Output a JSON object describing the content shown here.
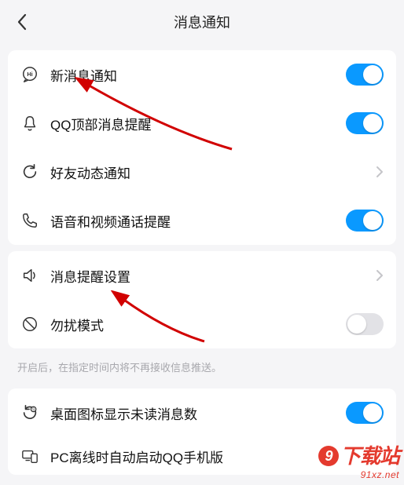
{
  "header": {
    "title": "消息通知"
  },
  "group1": {
    "items": [
      {
        "label": "新消息通知",
        "tail": "toggle",
        "state": "on"
      },
      {
        "label": "QQ顶部消息提醒",
        "tail": "toggle",
        "state": "on"
      },
      {
        "label": "好友动态通知",
        "tail": "chevron"
      },
      {
        "label": "语音和视频通话提醒",
        "tail": "toggle",
        "state": "on"
      }
    ]
  },
  "group2": {
    "items": [
      {
        "label": "消息提醒设置",
        "tail": "chevron"
      },
      {
        "label": "勿扰模式",
        "tail": "toggle",
        "state": "off"
      }
    ],
    "hint": "开启后，在指定时间内将不再接收信息推送。"
  },
  "group3": {
    "items": [
      {
        "label": "桌面图标显示未读消息数",
        "tail": "toggle",
        "state": "on"
      },
      {
        "label": "PC离线时自动启动QQ手机版",
        "tail": "none"
      }
    ]
  },
  "watermark": {
    "main_prefix": "9",
    "main_suffix": "下载站",
    "sub": "91xz.net"
  }
}
